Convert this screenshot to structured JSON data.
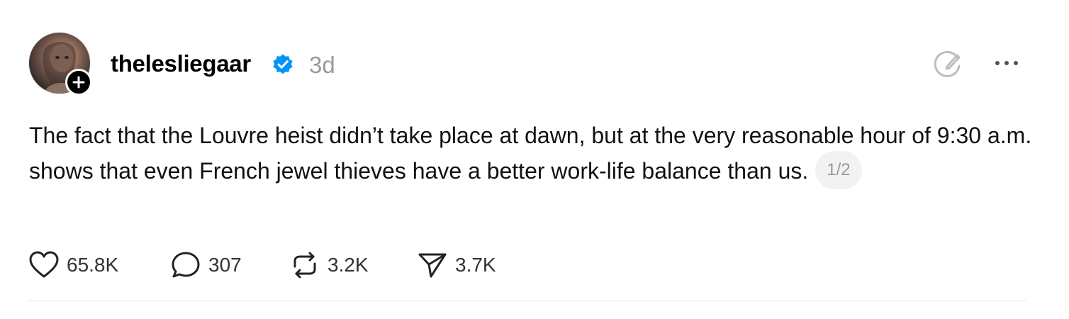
{
  "post": {
    "username": "thelesliegaar",
    "time": "3d",
    "body": "The fact that the Louvre heist didn’t take place at dawn, but at the very reasonable hour of 9:30 a.m. shows that even French jewel thieves have a better work-life balance than us.",
    "page_indicator": "1/2"
  },
  "actions": {
    "likes": "65.8K",
    "replies": "307",
    "reposts": "3.2K",
    "shares": "3.7K"
  },
  "icons": {
    "avatar": "avatar-photo",
    "follow": "plus-icon",
    "verified": "verified-badge-icon",
    "compose": "compose-icon",
    "more": "more-icon",
    "like": "heart-icon",
    "reply": "comment-icon",
    "repost": "repost-icon",
    "share": "send-icon"
  },
  "colors": {
    "verified": "#0095f6",
    "muted": "#999999",
    "text": "#000000"
  }
}
